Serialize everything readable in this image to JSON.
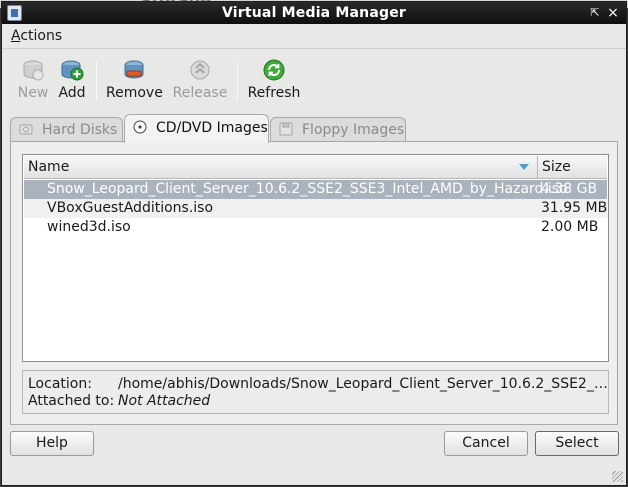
{
  "window": {
    "title": "Virtual Media Manager",
    "controls": {
      "restore": "⇱",
      "close": "×"
    }
  },
  "menu": {
    "actions": "Actions"
  },
  "toolbar": {
    "new": {
      "label": "New",
      "icon": "hard-disk-new-icon",
      "enabled": false
    },
    "add": {
      "label": "Add",
      "icon": "hard-disk-add-icon",
      "enabled": true
    },
    "remove": {
      "label": "Remove",
      "icon": "hard-disk-remove-icon",
      "enabled": true
    },
    "release": {
      "label": "Release",
      "icon": "hard-disk-release-icon",
      "enabled": false
    },
    "refresh": {
      "label": "Refresh",
      "icon": "refresh-icon",
      "enabled": true
    }
  },
  "tabs": [
    {
      "label": "Hard Disks",
      "icon": "hard-disk-icon",
      "active": false
    },
    {
      "label": "CD/DVD Images",
      "icon": "cd-dvd-icon",
      "active": true
    },
    {
      "label": "Floppy Images",
      "icon": "floppy-icon",
      "active": false
    }
  ],
  "list": {
    "columns": {
      "name": "Name",
      "size": "Size"
    },
    "rows": [
      {
        "name": "Snow_Leopard_Client_Server_10.6.2_SSE2_SSE3_Intel_AMD_by_Hazard.iso",
        "size": "4.38 GB",
        "selected": true
      },
      {
        "name": "VBoxGuestAdditions.iso",
        "size": "31.95 MB",
        "selected": false
      },
      {
        "name": "wined3d.iso",
        "size": "2.00 MB",
        "selected": false
      }
    ]
  },
  "info": {
    "location_label": "Location:",
    "location_value": "/home/abhis/Downloads/Snow_Leopard_Client_Server_10.6.2_SSE2_SSE3...",
    "attached_label": "Attached to:",
    "attached_value": "Not Attached"
  },
  "buttons": {
    "help": "Help",
    "cancel": "Cancel",
    "select": "Select"
  },
  "colors": {
    "selection": "#a9b2bd",
    "titlebar": "#111111"
  }
}
